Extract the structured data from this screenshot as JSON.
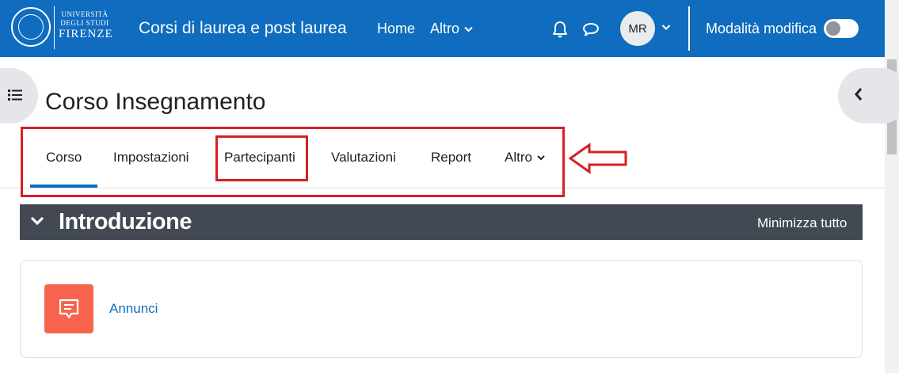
{
  "navbar": {
    "logo_lines": [
      "UNIVERSITÀ",
      "DEGLI STUDI",
      "FIRENZE"
    ],
    "site_title": "Corsi di laurea e post laurea",
    "links": {
      "home": "Home",
      "more": "Altro"
    },
    "icons": [
      "bell-icon",
      "chat-icon",
      "chevron-down-icon"
    ],
    "avatar_initials": "MR",
    "edit_mode_label": "Modalità modifica",
    "edit_mode_on": false,
    "color": "#0f6cbf"
  },
  "page": {
    "title": "Corso Insegnamento"
  },
  "secondary_nav": {
    "tabs": [
      {
        "label": "Corso",
        "active": true
      },
      {
        "label": "Impostazioni",
        "active": false
      },
      {
        "label": "Partecipanti",
        "active": false,
        "highlighted": true
      },
      {
        "label": "Valutazioni",
        "active": false
      },
      {
        "label": "Report",
        "active": false
      },
      {
        "label": "Altro",
        "active": false,
        "dropdown": true
      }
    ]
  },
  "annotations": {
    "highlight_color": "#d61f26",
    "arrow_direction": "left"
  },
  "section": {
    "title": "Introduzione",
    "collapse_all": "Minimizza tutto",
    "bar_color": "#424952"
  },
  "activities": [
    {
      "name": "Annunci",
      "type": "forum",
      "icon_color": "#f7634d"
    }
  ]
}
